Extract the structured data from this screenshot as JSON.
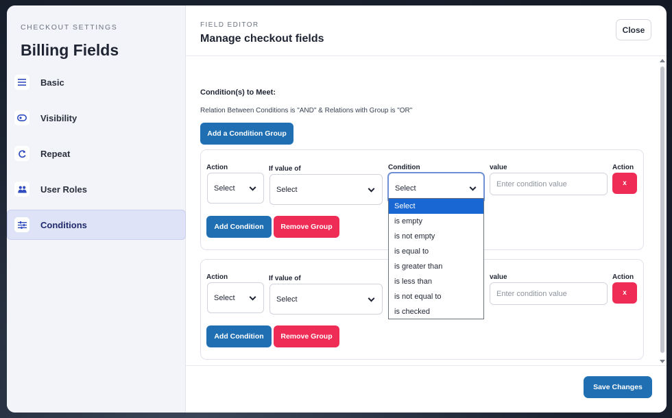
{
  "sidebar": {
    "eyebrow": "CHECKOUT SETTINGS",
    "title": "Billing Fields",
    "items": [
      {
        "label": "Basic",
        "icon": "menu-icon"
      },
      {
        "label": "Visibility",
        "icon": "eye-icon"
      },
      {
        "label": "Repeat",
        "icon": "repeat-icon"
      },
      {
        "label": "User Roles",
        "icon": "users-icon"
      },
      {
        "label": "Conditions",
        "icon": "sliders-icon",
        "active": true
      }
    ]
  },
  "header": {
    "eyebrow": "FIELD EDITOR",
    "title": "Manage checkout fields",
    "close_label": "Close"
  },
  "conditions": {
    "heading": "Condition(s) to Meet:",
    "relation": "Relation Between Conditions is \"AND\" & Relations with Group is \"OR\"",
    "add_group_label": "Add a Condition Group",
    "groups": [
      {
        "action_label": "Action",
        "if_value_label": "If value of",
        "condition_label": "Condition",
        "value_label": "value",
        "action2_label": "Action",
        "action_value": "Select",
        "if_value_value": "Select",
        "condition_value": "Select",
        "value_placeholder": "Enter condition value",
        "remove_x": "x",
        "add_condition_label": "Add Condition",
        "remove_group_label": "Remove Group"
      },
      {
        "action_label": "Action",
        "if_value_label": "If value of",
        "value_label": "value",
        "action2_label": "Action",
        "action_value": "Select",
        "if_value_value": "Select",
        "value_placeholder": "Enter condition value",
        "remove_x": "x",
        "add_condition_label": "Add Condition",
        "remove_group_label": "Remove Group"
      }
    ],
    "dropdown_options": [
      "Select",
      "is empty",
      "is not empty",
      "is equal to",
      "is greater than",
      "is less than",
      "is not equal to",
      "is checked"
    ],
    "dropdown_selected": "Select"
  },
  "footer": {
    "save_label": "Save Changes"
  },
  "colors": {
    "primary": "#1f6fb2",
    "danger": "#ee2c55",
    "selected_option": "#1967d2"
  }
}
